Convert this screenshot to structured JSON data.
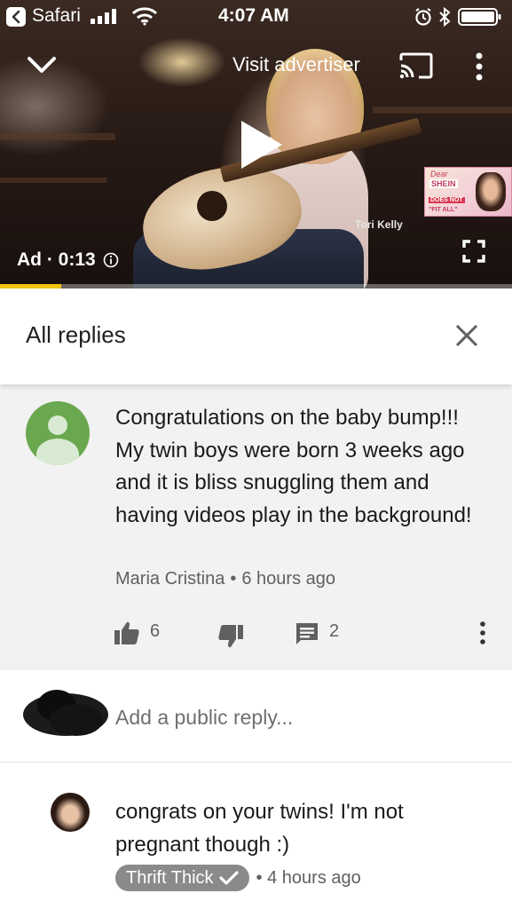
{
  "status_bar": {
    "back_app": "Safari",
    "time": "4:07 AM"
  },
  "video": {
    "visit_advertiser": "Visit advertiser",
    "ad_label": "Ad · 0:13",
    "progress_fraction": 0.12,
    "progress_color": "#f2c40f",
    "overlay_caption": "Tori Kelly",
    "ad_thumbnail": {
      "line1": "Dear",
      "line2": "SHEIN",
      "line3": "DOES NOT",
      "line4": "\"FIT ALL\""
    },
    "icons": [
      "chevron-down-icon",
      "cast-icon",
      "more-vert-icon",
      "play-icon",
      "info-icon",
      "fullscreen-icon"
    ]
  },
  "panel": {
    "title": "All replies"
  },
  "parent_comment": {
    "text": "Congratulations on the baby bump!!! My twin boys were born 3 weeks ago and it is bliss snuggling them and having videos play in the background!",
    "author": "Maria Cristina",
    "time": "6 hours ago",
    "likes": "6",
    "replies": "2",
    "avatar_color": "#6aa84f"
  },
  "add_reply": {
    "placeholder": "Add a public reply..."
  },
  "reply": {
    "text": "congrats on your twins! I'm not pregnant though :)",
    "author": "Thrift Thick",
    "time": "4 hours ago"
  }
}
